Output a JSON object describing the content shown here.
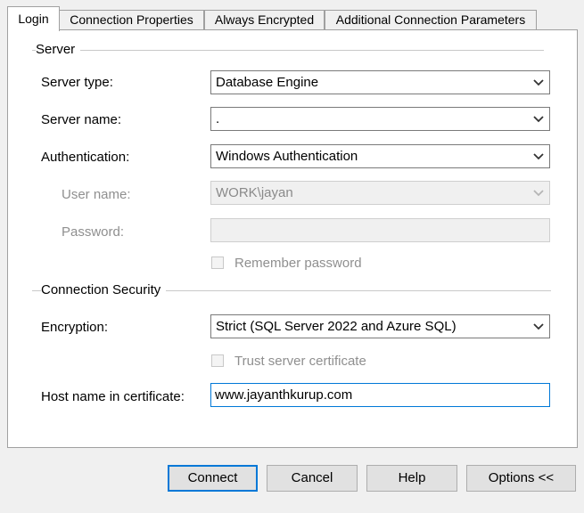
{
  "tabs": [
    {
      "label": "Login"
    },
    {
      "label": "Connection Properties"
    },
    {
      "label": "Always Encrypted"
    },
    {
      "label": "Additional Connection Parameters"
    }
  ],
  "server_group": {
    "title": "Server",
    "server_type": {
      "label": "Server type:",
      "value": "Database Engine"
    },
    "server_name": {
      "label": "Server name:",
      "value": "."
    },
    "authentication": {
      "label": "Authentication:",
      "value": "Windows Authentication"
    },
    "user_name": {
      "label": "User name:",
      "value": "WORK\\jayan"
    },
    "password": {
      "label": "Password:",
      "value": ""
    },
    "remember_password": {
      "label": "Remember password",
      "checked": false
    }
  },
  "security_group": {
    "title": "Connection Security",
    "encryption": {
      "label": "Encryption:",
      "value": "Strict (SQL Server 2022 and Azure SQL)"
    },
    "trust_cert": {
      "label": "Trust server certificate",
      "checked": false
    },
    "host_name": {
      "label": "Host name in certificate:",
      "value": "www.jayanthkurup.com"
    }
  },
  "buttons": {
    "connect": "Connect",
    "cancel": "Cancel",
    "help": "Help",
    "options": "Options <<"
  },
  "colors": {
    "focus_border": "#0078d7",
    "disabled_text": "#8f8f8f"
  }
}
